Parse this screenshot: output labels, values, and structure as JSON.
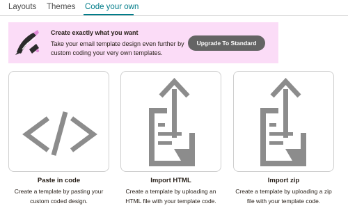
{
  "tabs": [
    {
      "label": "Layouts",
      "active": false
    },
    {
      "label": "Themes",
      "active": false
    },
    {
      "label": "Code your own",
      "active": true
    }
  ],
  "banner": {
    "title": "Create exactly what you want",
    "body": "Take your email template design even further by custom coding your very own templates.",
    "button_label": "Upgrade To Standard"
  },
  "cards": [
    {
      "title": "Paste in code",
      "description": "Create a template by pasting your custom coded design.",
      "icon": "code-brackets-icon"
    },
    {
      "title": "Import HTML",
      "description": "Create a template by uploading an HTML file with your template code.",
      "icon": "upload-document-icon"
    },
    {
      "title": "Import zip",
      "description": "Create a template by uploading a zip file with your template code.",
      "icon": "upload-document-icon"
    }
  ],
  "colors": {
    "accent": "#007c89",
    "banner_bg": "#fbdcf7",
    "button_bg": "#646464",
    "icon_gray": "#8c8c8c"
  }
}
